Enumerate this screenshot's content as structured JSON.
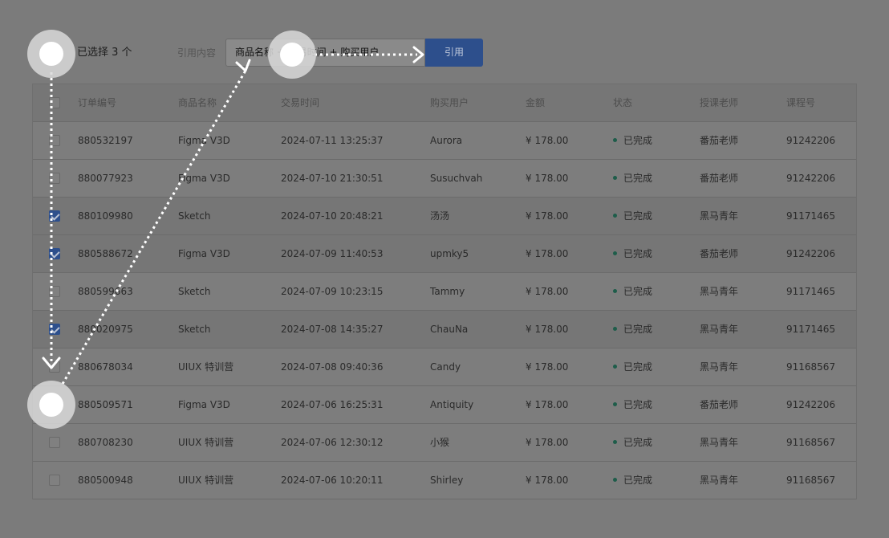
{
  "toolbar": {
    "selected_count": "已选择 3 个",
    "ref_label": "引用内容",
    "ref_input_value": "商品名称 + 交易时间 + 购买用户",
    "ref_button": "引用"
  },
  "table": {
    "headers": {
      "order": "订单编号",
      "product": "商品名称",
      "time": "交易时间",
      "user": "购买用户",
      "amount": "金额",
      "status": "状态",
      "teacher": "授课老师",
      "course": "课程号"
    },
    "rows": [
      {
        "checked": false,
        "order": "880532197",
        "product": "Figma V3D",
        "time": "2024-07-11 13:25:37",
        "user": "Aurora",
        "amount": "¥ 178.00",
        "status": "已完成",
        "teacher": "番茄老师",
        "course": "91242206"
      },
      {
        "checked": false,
        "order": "880077923",
        "product": "Figma V3D",
        "time": "2024-07-10 21:30:51",
        "user": "Susuchvah",
        "amount": "¥ 178.00",
        "status": "已完成",
        "teacher": "番茄老师",
        "course": "91242206"
      },
      {
        "checked": true,
        "order": "880109980",
        "product": "Sketch",
        "time": "2024-07-10 20:48:21",
        "user": "汤汤",
        "amount": "¥ 178.00",
        "status": "已完成",
        "teacher": "黑马青年",
        "course": "91171465"
      },
      {
        "checked": true,
        "order": "880588672",
        "product": "Figma V3D",
        "time": "2024-07-09 11:40:53",
        "user": "upmky5",
        "amount": "¥ 178.00",
        "status": "已完成",
        "teacher": "番茄老师",
        "course": "91242206"
      },
      {
        "checked": false,
        "order": "880599663",
        "product": "Sketch",
        "time": "2024-07-09 10:23:15",
        "user": "Tammy",
        "amount": "¥ 178.00",
        "status": "已完成",
        "teacher": "黑马青年",
        "course": "91171465"
      },
      {
        "checked": true,
        "order": "880020975",
        "product": "Sketch",
        "time": "2024-07-08 14:35:27",
        "user": "ChauNa",
        "amount": "¥ 178.00",
        "status": "已完成",
        "teacher": "黑马青年",
        "course": "91171465"
      },
      {
        "checked": false,
        "order": "880678034",
        "product": "UIUX 特训营",
        "time": "2024-07-08 09:40:36",
        "user": "Candy",
        "amount": "¥ 178.00",
        "status": "已完成",
        "teacher": "黑马青年",
        "course": "91168567"
      },
      {
        "checked": false,
        "order": "880509571",
        "product": "Figma V3D",
        "time": "2024-07-06 16:25:31",
        "user": "Antiquity",
        "amount": "¥ 178.00",
        "status": "已完成",
        "teacher": "番茄老师",
        "course": "91242206"
      },
      {
        "checked": false,
        "order": "880708230",
        "product": "UIUX 特训营",
        "time": "2024-07-06 12:30:12",
        "user": "小猴",
        "amount": "¥ 178.00",
        "status": "已完成",
        "teacher": "黑马青年",
        "course": "91168567"
      },
      {
        "checked": false,
        "order": "880500948",
        "product": "UIUX 特训营",
        "time": "2024-07-06 10:20:11",
        "user": "Shirley",
        "amount": "¥ 178.00",
        "status": "已完成",
        "teacher": "黑马青年",
        "course": "91168567"
      }
    ]
  },
  "colors": {
    "accent": "#2d4f8c",
    "status_ok": "#1e5d4a"
  }
}
